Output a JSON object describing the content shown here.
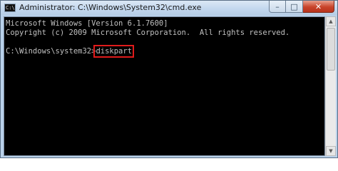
{
  "window": {
    "title": "Administrator: C:\\Windows\\System32\\cmd.exe",
    "icon": "cmd-icon",
    "icon_glyph": "C:\\"
  },
  "controls": {
    "minimize": "–",
    "maximize": "□",
    "close": "✕"
  },
  "console": {
    "lines": [
      "Microsoft Windows [Version 6.1.7600]",
      "Copyright (c) 2009 Microsoft Corporation.  All rights reserved.",
      "",
      ""
    ],
    "prompt": "C:\\Windows\\system32>",
    "command": "diskpart",
    "highlight_color": "#e01b1b"
  }
}
